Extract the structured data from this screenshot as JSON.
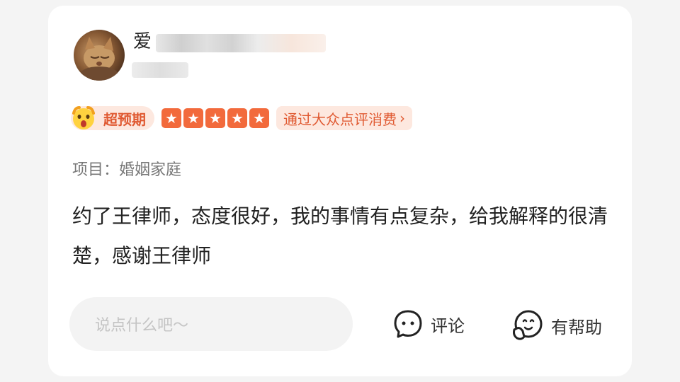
{
  "user": {
    "name_visible": "爱"
  },
  "rating": {
    "badge_label": "超预期",
    "stars": 5,
    "star_glyph": "★",
    "consume_link_label": "通过大众点评消费",
    "chevron": "›"
  },
  "project": {
    "label": "项目：",
    "value": "婚姻家庭"
  },
  "review": {
    "text": "约了王律师，态度很好，我的事情有点复杂，给我解释的很清楚，感谢王律师"
  },
  "actions": {
    "comment_placeholder": "说点什么吧～",
    "comment_label": "评论",
    "helpful_label": "有帮助"
  },
  "colors": {
    "accent": "#f26a3c",
    "badge_bg": "#fde8df",
    "badge_text": "#e05a32"
  }
}
